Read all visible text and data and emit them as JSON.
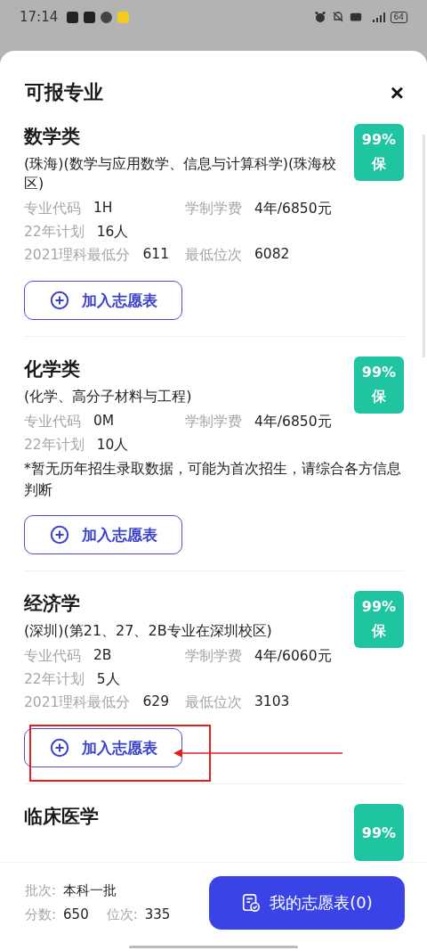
{
  "status_bar": {
    "time": "17:14",
    "battery": "64"
  },
  "sheet": {
    "title": "可报专业",
    "close": "×"
  },
  "majors": [
    {
      "name": "数学类",
      "detail": "(珠海)(数学与应用数学、信息与计算科学)(珠海校区)",
      "badge": {
        "percent": "99%",
        "tag": "保"
      },
      "info": [
        [
          {
            "label": "专业代码",
            "value": "1H"
          },
          {
            "label": "学制学费",
            "value": "4年/6850元"
          }
        ],
        [
          {
            "label": "22年计划",
            "value": "16人"
          }
        ],
        [
          {
            "label": "2021理科最低分",
            "value": "611"
          },
          {
            "label": "最低位次",
            "value": "6082"
          }
        ]
      ],
      "button": "加入志愿表",
      "highlighted": false
    },
    {
      "name": "化学类",
      "detail": "(化学、高分子材料与工程)",
      "badge": {
        "percent": "99%",
        "tag": "保"
      },
      "info": [
        [
          {
            "label": "专业代码",
            "value": "0M"
          },
          {
            "label": "学制学费",
            "value": "4年/6850元"
          }
        ],
        [
          {
            "label": "22年计划",
            "value": "10人"
          }
        ]
      ],
      "note": "*暂无历年招生录取数据，可能为首次招生，请综合各方信息判断",
      "button": "加入志愿表",
      "highlighted": false
    },
    {
      "name": "经济学",
      "detail": "(深圳)(第21、27、2B专业在深圳校区)",
      "badge": {
        "percent": "99%",
        "tag": "保"
      },
      "info": [
        [
          {
            "label": "专业代码",
            "value": "2B"
          },
          {
            "label": "学制学费",
            "value": "4年/6060元"
          }
        ],
        [
          {
            "label": "22年计划",
            "value": "5人"
          }
        ],
        [
          {
            "label": "2021理科最低分",
            "value": "629"
          },
          {
            "label": "最低位次",
            "value": "3103"
          }
        ]
      ],
      "button": "加入志愿表",
      "highlighted": true
    },
    {
      "name": "临床医学",
      "badge": {
        "percent": "99%"
      },
      "highlighted": false
    }
  ],
  "footer": {
    "batch_label": "批次:",
    "batch": "本科一批",
    "score_label": "分数:",
    "score": "650",
    "rank_label": "位次:",
    "rank": "335",
    "button": "我的志愿表(0)"
  }
}
